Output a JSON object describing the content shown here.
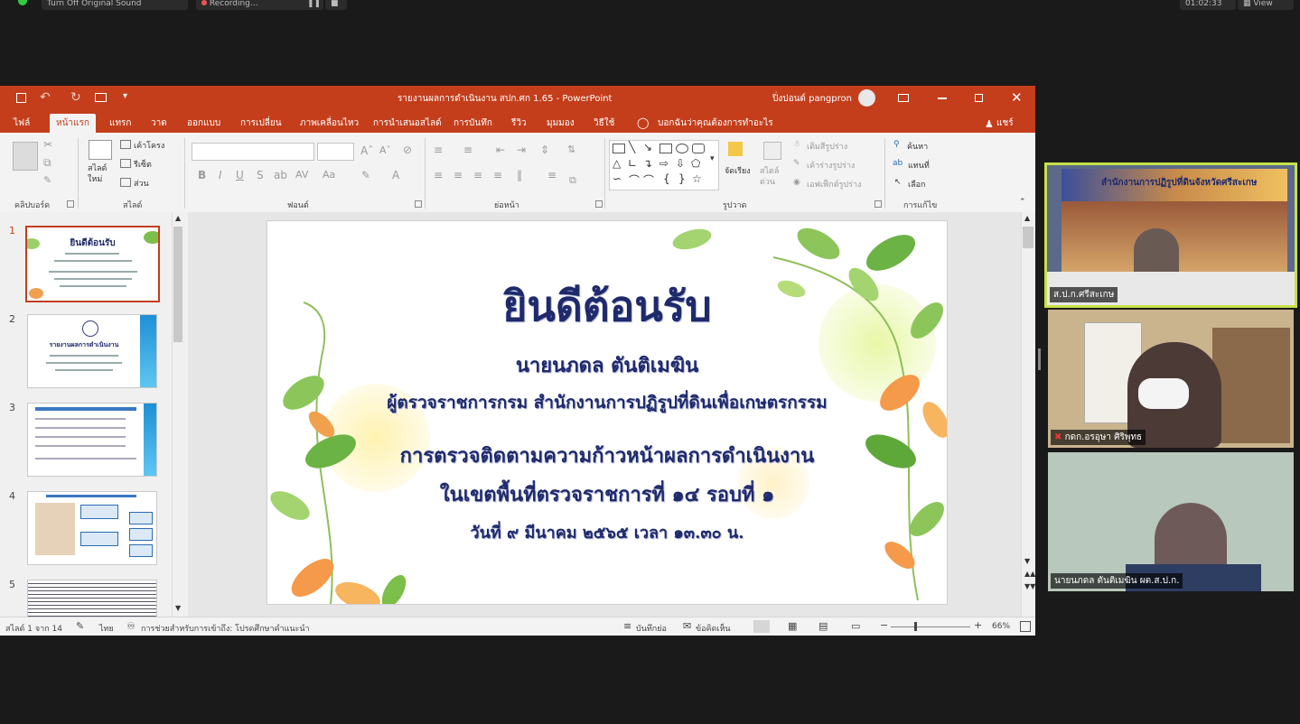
{
  "zoom_bar": {
    "audio_label": "Turn Off Original Sound",
    "recording_label": "Recording...",
    "timer": "01:02:33",
    "view_label": "View"
  },
  "window": {
    "title": "รายงานผลการดำเนินงาน สปก.ศก 1.65  -  PowerPoint",
    "user_name": "ปิ่งปอนด์ pangpron"
  },
  "tabs": [
    "ไฟล์",
    "หน้าแรก",
    "แทรก",
    "วาด",
    "ออกแบบ",
    "การเปลี่ยน",
    "ภาพเคลื่อนไหว",
    "การนำเสนอสไลด์",
    "การบันทึก",
    "รีวิว",
    "มุมมอง",
    "วิธีใช้"
  ],
  "tell_me": "บอกฉันว่าคุณต้องการทำอะไร",
  "share_label": "แชร์",
  "ribbon": {
    "groups": [
      "คลิปบอร์ด",
      "สไลด์",
      "ฟอนต์",
      "ย่อหน้า",
      "รูปวาด",
      "การแก้ไข"
    ],
    "new_slide": "สไลด์ ใหม่",
    "layout": "เค้าโครง",
    "reset": "รีเซ็ต",
    "section": "ส่วน",
    "arrange": "จัดเรียง",
    "quick_styles": "สไตล์ ด่วน",
    "shape_fill": "เติมสีรูปร่าง",
    "shape_outline": "เค้าร่างรูปร่าง",
    "shape_effects": "เอฟเฟ็กต์รูปร่าง",
    "find": "ค้นหา",
    "replace": "แทนที่",
    "select": "เลือก"
  },
  "thumbnails": [
    {
      "num": "1",
      "title": "ยินดีต้อนรับ"
    },
    {
      "num": "2",
      "title": "รายงานผลการดำเนินงาน"
    },
    {
      "num": "3",
      "title": ""
    },
    {
      "num": "4",
      "title": ""
    },
    {
      "num": "5",
      "title": ""
    }
  ],
  "slide": {
    "title": "ยินดีต้อนรับ",
    "name": "นายนภดล   ตันติเมฆิน",
    "position": "ผู้ตรวจราชการกรม  สำนักงานการปฏิรูปที่ดินเพื่อเกษตรกรรม",
    "line1": "การตรวจติดตามความก้าวหน้าผลการดำเนินงาน",
    "line2": "ในเขตพื้นที่ตรวจราชการที่   ๑๔   รอบที่   ๑",
    "line3": "วันที่   ๙  มีนาคม  ๒๕๖๕   เวลา ๑๓.๓๐ น."
  },
  "status": {
    "slide_count": "สไลด์ 1 จาก 14",
    "language": "ไทย",
    "accessibility": "การช่วยสำหรับการเข้าถึง: โปรดศึกษาคำแนะนำ",
    "notes": "บันทึกย่อ",
    "comments": "ข้อคิดเห็น",
    "zoom": "66%"
  },
  "participants": [
    {
      "name": "ส.ป.ก.ศรีสะเกษ",
      "banner": "สำนักงานการปฏิรูปที่ดินจังหวัดศรีสะเกษ"
    },
    {
      "name": "กดก.อรอุษา ศิริพุทธ"
    },
    {
      "name": "นายนภดล ตันติเมฆิน ผต.ส.ป.ก."
    }
  ],
  "colors": {
    "ppt_accent": "#c43e1c",
    "slide_text": "#1f2a6b",
    "active_speaker": "#c8e04a"
  }
}
